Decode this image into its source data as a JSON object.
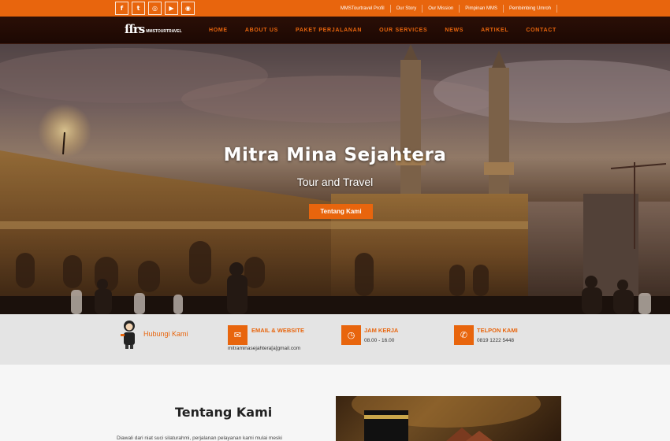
{
  "topbar": {
    "social": [
      {
        "icon": "facebook-icon",
        "glyph": "f"
      },
      {
        "icon": "twitter-icon",
        "glyph": "t"
      },
      {
        "icon": "instagram-icon",
        "glyph": "◎"
      },
      {
        "icon": "youtube-icon",
        "glyph": "▶"
      },
      {
        "icon": "rss-icon",
        "glyph": "◉"
      }
    ],
    "links": [
      "MMSTourtravel Profil",
      "Our Story",
      "Our Mission",
      "Pimpinan MMS",
      "Pembimbing Umroh"
    ]
  },
  "nav": {
    "logo_mark": "ſſrs",
    "logo_text": "MMSTOURTRAVEL",
    "items": [
      "HOME",
      "ABOUT US",
      "PAKET PERJALANAN",
      "OUR SERVICES",
      "NEWS",
      "ARTIKEL",
      "CONTACT"
    ]
  },
  "hero": {
    "title": "Mitra Mina Sejahtera",
    "subtitle": "Tour and Travel",
    "button": "Tentang Kami"
  },
  "contact": {
    "hubungi": "Hubungi Kami",
    "email": {
      "heading": "EMAIL & WEBSITE",
      "value": "mitraminasejahtera[a]gmail.com",
      "icon": "envelope-icon"
    },
    "hours": {
      "heading": "JAM KERJA",
      "value": "08.00 - 16.00",
      "icon": "clock-icon"
    },
    "phone": {
      "heading": "TELPON KAMI",
      "value": "0819 1222 5448",
      "icon": "phone-icon"
    }
  },
  "about": {
    "title": "Tentang Kami",
    "text": "Diawali dari niat suci silaturahmi, perjalanan pelayanan kami mulai meski"
  },
  "colors": {
    "accent": "#e8650d",
    "nav_bg": "#230b05"
  }
}
